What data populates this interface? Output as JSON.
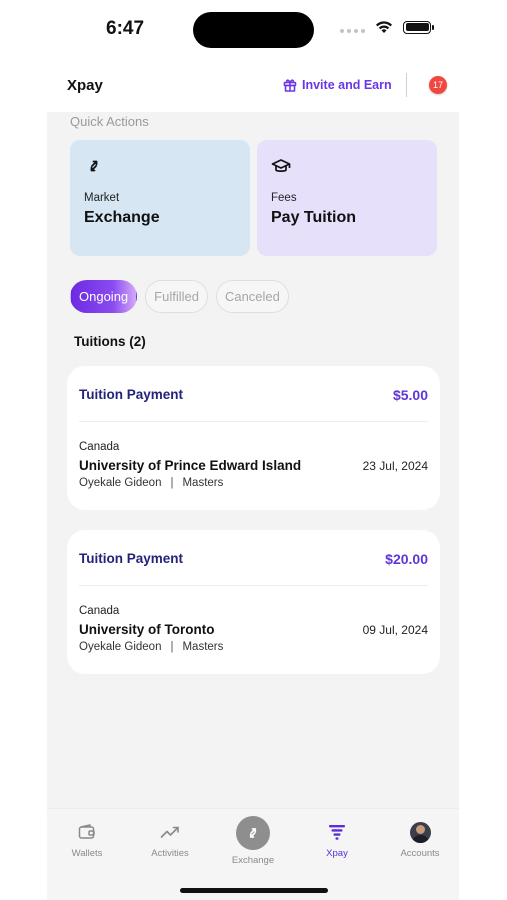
{
  "status_bar": {
    "time": "6:47"
  },
  "header": {
    "brand": "Xpay",
    "invite_label": "Invite and Earn",
    "notification_count": "17"
  },
  "quick_actions": {
    "title": "Quick Actions",
    "cards": [
      {
        "sub": "Market",
        "label": "Exchange",
        "icon": "exchange-arrows-icon",
        "color": "#d6e6f2"
      },
      {
        "sub": "Fees",
        "label": "Pay Tuition",
        "icon": "graduation-cap-icon",
        "color": "#e6e0fb"
      }
    ]
  },
  "filters": {
    "items": [
      "Ongoing",
      "Fulfilled",
      "Canceled"
    ],
    "selected": "Ongoing"
  },
  "section_title": "Tuitions (2)",
  "payments": [
    {
      "title": "Tuition Payment",
      "amount": "$5.00",
      "country": "Canada",
      "university": "University of Prince Edward Island",
      "date": "23 Jul, 2024",
      "student": "Oyekale Gideon",
      "separator": "|",
      "level": "Masters"
    },
    {
      "title": "Tuition Payment",
      "amount": "$20.00",
      "country": "Canada",
      "university": "University of Toronto",
      "date": "09 Jul, 2024",
      "student": "Oyekale Gideon",
      "separator": "|",
      "level": "Masters"
    }
  ],
  "bottom_nav": {
    "items": [
      {
        "label": "Wallets",
        "icon": "wallet-icon"
      },
      {
        "label": "Activities",
        "icon": "trending-up-icon"
      },
      {
        "label": "Exchange",
        "icon": "exchange-arrows-icon"
      },
      {
        "label": "Xpay",
        "icon": "xpay-logo-icon"
      },
      {
        "label": "Accounts",
        "icon": "avatar-icon"
      }
    ],
    "active": "Xpay"
  },
  "colors": {
    "accent": "#6b35e8",
    "amount": "#5f35d8",
    "title": "#24237a",
    "badge": "#f2473f"
  }
}
